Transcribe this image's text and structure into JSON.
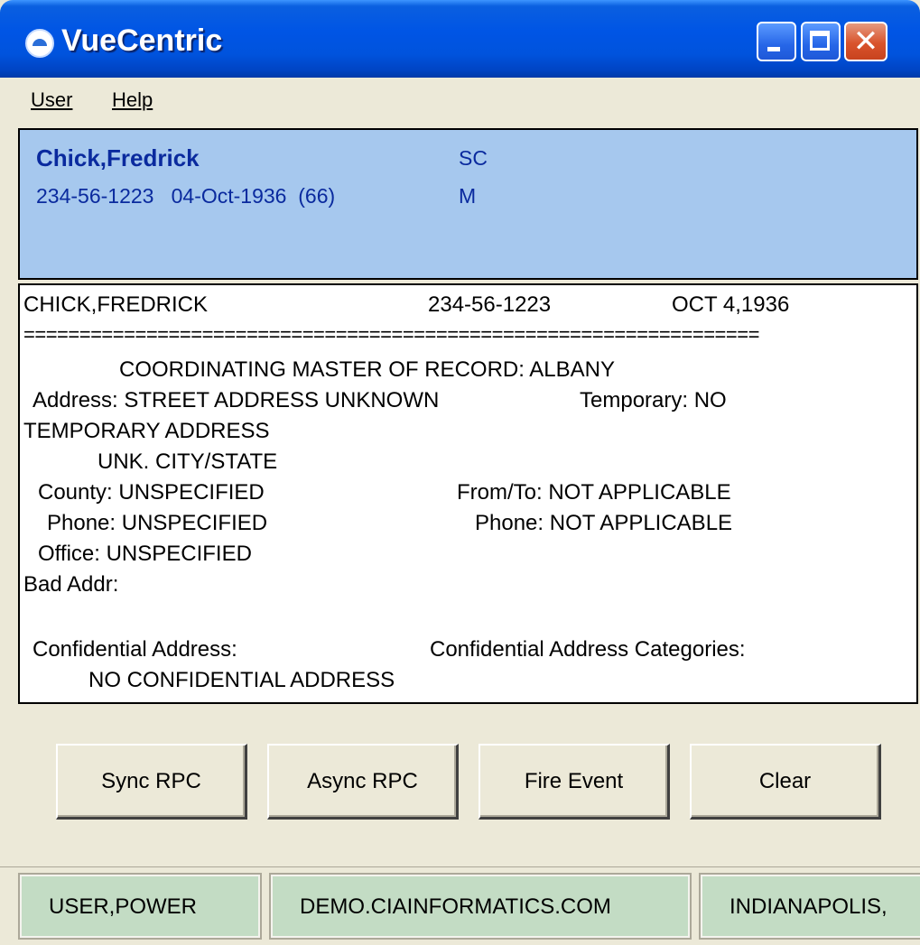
{
  "window": {
    "title": "VueCentric"
  },
  "menu": {
    "user": "User",
    "help": "Help"
  },
  "patient": {
    "name": "Chick,Fredrick",
    "status": "SC",
    "ssn_dob_age": "234-56-1223   04-Oct-1936  (66)",
    "sex": "M"
  },
  "report": {
    "header_name": "CHICK,FREDRICK",
    "header_ssn": "234-56-1223",
    "header_dob": "OCT 4,1936",
    "separator": "==================================================================",
    "lines": [
      "COORDINATING MASTER OF RECORD: ALBANY",
      "Address: STREET ADDRESS UNKNOWN",
      "Temporary: NO",
      "TEMPORARY ADDRESS",
      "UNK. CITY/STATE",
      "County: UNSPECIFIED",
      "From/To: NOT APPLICABLE",
      "Phone: UNSPECIFIED",
      "Phone: NOT APPLICABLE",
      "Office: UNSPECIFIED",
      "Bad Addr:",
      "Confidential Address:",
      "Confidential Address Categories:",
      "NO CONFIDENTIAL ADDRESS"
    ]
  },
  "buttons": {
    "sync": "Sync RPC",
    "async": "Async RPC",
    "fire": "Fire Event",
    "clear": "Clear"
  },
  "statusbar": {
    "user": "USER,POWER",
    "server": "DEMO.CIAINFORMATICS.COM",
    "site": "INDIANAPOLIS,"
  }
}
